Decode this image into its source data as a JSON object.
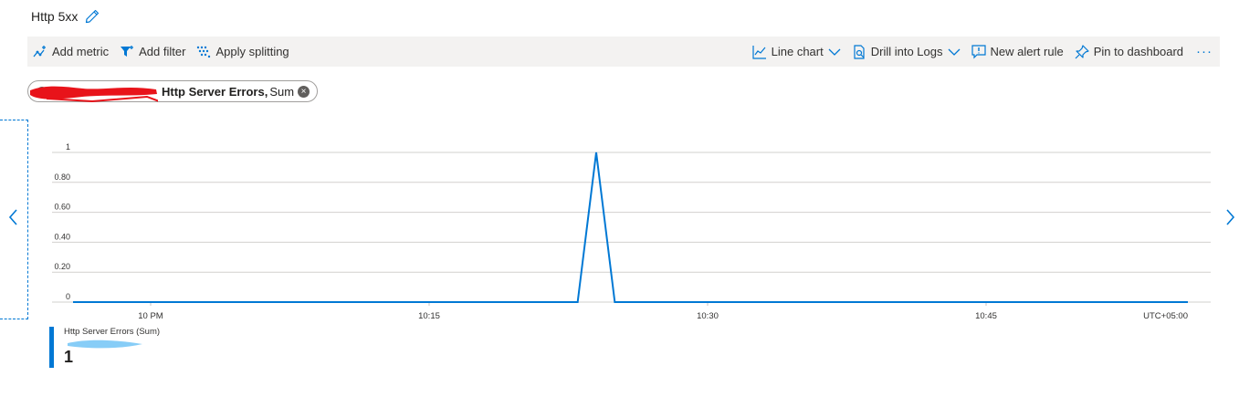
{
  "header": {
    "title": "Http 5xx",
    "edit_icon": "pencil-icon"
  },
  "toolbar": {
    "left": [
      {
        "label": "Add metric",
        "icon": "add-metric-icon"
      },
      {
        "label": "Add filter",
        "icon": "filter-icon"
      },
      {
        "label": "Apply splitting",
        "icon": "splitting-icon"
      }
    ],
    "right": [
      {
        "label": "Line chart",
        "icon": "line-chart-icon",
        "dropdown": true
      },
      {
        "label": "Drill into Logs",
        "icon": "logs-icon",
        "dropdown": true
      },
      {
        "label": "New alert rule",
        "icon": "alert-icon"
      },
      {
        "label": "Pin to dashboard",
        "icon": "pin-icon"
      }
    ],
    "more_label": "···"
  },
  "metric_pill": {
    "metric": "Http Server Errors,",
    "aggregation": "Sum",
    "remove_icon": "close-circle-icon",
    "remove_label": "×"
  },
  "colors": {
    "accent": "#0078d4",
    "toolbar_bg": "#f3f2f1",
    "redaction_red": "#e8131a",
    "redaction_blue": "#87cdf7"
  },
  "nav": {
    "prev_icon": "chevron-left-icon",
    "next_icon": "chevron-right-icon"
  },
  "chart_data": {
    "type": "line",
    "x_ticks": [
      "10 PM",
      "10:15",
      "10:30",
      "10:45"
    ],
    "timezone": "UTC+05:00",
    "y_ticks": [
      "0",
      "0.20",
      "0.40",
      "0.60",
      "0.80",
      "1"
    ],
    "ylim": [
      0,
      1
    ],
    "grid": true,
    "series": [
      {
        "name": "Http Server Errors (Sum)",
        "x_minutes_after_10pm": [
          -4,
          23,
          24,
          25,
          56
        ],
        "values": [
          0,
          0,
          1,
          0,
          0
        ]
      }
    ]
  },
  "legend": {
    "name": "Http Server Errors (Sum)",
    "value": "1"
  }
}
